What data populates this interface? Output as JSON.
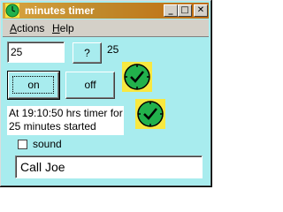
{
  "window": {
    "title": "minutes timer",
    "controls": {
      "minimize": "_",
      "maximize": "□",
      "close": "✕"
    }
  },
  "menu": {
    "actions_first": "A",
    "actions_rest": "ctions",
    "help_first": "H",
    "help_rest": "elp"
  },
  "timer": {
    "minutes_value": "25",
    "query_button": "?",
    "minutes_display": "25",
    "on_button": "on",
    "off_button": "off",
    "status_text": "At 19:10:50 hrs timer for 25 minutes started",
    "sound_label": "sound",
    "sound_checked": false,
    "message_value": "Call Joe"
  },
  "icons": {
    "app": "green-clock-icon",
    "status_on": "green-clock-check-icon",
    "status_started": "green-clock-check-icon"
  },
  "colors": {
    "window_bg": "#a8ecee",
    "title_bar": "#c08a2c",
    "icon_green": "#22b14c",
    "icon_yellow": "#f8e840"
  }
}
